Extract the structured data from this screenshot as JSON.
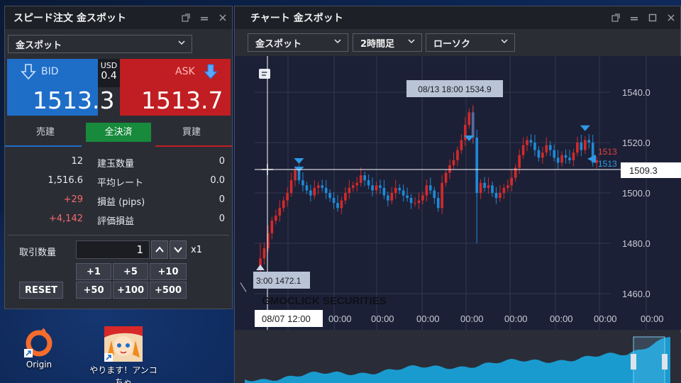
{
  "order_panel": {
    "title": "スピード注文 金スポット",
    "instrument": "金スポット",
    "bid_label": "BID",
    "ask_label": "ASK",
    "bid_price": "1513.3",
    "ask_price": "1513.7",
    "spread_currency": "USD",
    "spread_value": "0.4",
    "tabs": {
      "sell": "売建",
      "close_all": "全決済",
      "buy": "買建"
    },
    "stats": [
      {
        "left": "12",
        "label": "建玉数量",
        "right": "0",
        "left_color": "normal"
      },
      {
        "left": "1,516.6",
        "label": "平均レート",
        "right": "0.0",
        "left_color": "normal"
      },
      {
        "left": "+29",
        "label": "損益 (pips)",
        "right": "0",
        "left_color": "red"
      },
      {
        "left": "+4,142",
        "label": "評価損益",
        "right": "0",
        "left_color": "red"
      }
    ],
    "quantity_label": "取引数量",
    "quantity_value": "1",
    "multiplier": "x1",
    "reset_label": "RESET",
    "quick_buttons": [
      "+1",
      "+5",
      "+10",
      "+50",
      "+100",
      "+500"
    ]
  },
  "chart_panel": {
    "title": "チャート 金スポット",
    "instrument": "金スポット",
    "timeframe": "2時間足",
    "chart_style": "ローソク",
    "watermark": "GMOCLICK SECURITIES",
    "crosshair_price": "1509.3",
    "crosshair_time": "08/07 12:00",
    "high_annotation": "08/13 18:00 1534.9",
    "low_annotation": "3:00 1472.1",
    "right_tag_ask": "1513",
    "right_tag_bid": "1513",
    "x_tick_label": "00:00"
  },
  "desktop": {
    "icons": [
      {
        "label": "Origin"
      },
      {
        "label": "やります！アンコちゃ"
      }
    ]
  },
  "colors": {
    "up": "#d42a2a",
    "down": "#1e8ad8",
    "bid_bg": "#1e6ec8",
    "ask_bg": "#c01e22",
    "close_all_bg": "#178a3c",
    "chart_bg": "#1c2036",
    "navigator_fill": "#1a9bd0"
  },
  "chart_data": {
    "type": "candlestick",
    "y_ticks": [
      1540,
      1520,
      1500,
      1480,
      1460
    ],
    "ylim": [
      1455,
      1545
    ],
    "x_tick_labels": [
      "00:00",
      "00:00",
      "00:00",
      "00:00",
      "00:00",
      "00:00",
      "00:00",
      "00:00",
      "00:00"
    ],
    "close_series": [
      1474,
      1478,
      1484,
      1489,
      1491,
      1494,
      1497,
      1500,
      1505,
      1509,
      1505,
      1503,
      1501,
      1499,
      1502,
      1503,
      1502,
      1500,
      1498,
      1496,
      1494,
      1497,
      1500,
      1502,
      1503,
      1504,
      1507,
      1505,
      1503,
      1501,
      1503,
      1502,
      1499,
      1497,
      1500,
      1502,
      1501,
      1499,
      1498,
      1496,
      1496,
      1497,
      1499,
      1503,
      1501,
      1498,
      1494,
      1504,
      1508,
      1511,
      1513,
      1517,
      1521,
      1527,
      1532,
      1522,
      1500,
      1504,
      1502,
      1503,
      1500,
      1498,
      1500,
      1502,
      1503,
      1506,
      1510,
      1515,
      1519,
      1521,
      1520,
      1517,
      1514,
      1516,
      1519,
      1517,
      1514,
      1512,
      1515,
      1514,
      1513,
      1516,
      1520,
      1517,
      1521,
      1520,
      1512,
      1513
    ],
    "markers": [
      {
        "type": "down-triangle",
        "index": 10,
        "value": 1511
      },
      {
        "type": "down-triangle",
        "index": 54,
        "value": 1520
      },
      {
        "type": "down-triangle",
        "index": 84,
        "value": 1524
      },
      {
        "type": "up-triangle",
        "index": 0,
        "value": 1472.1
      }
    ]
  }
}
